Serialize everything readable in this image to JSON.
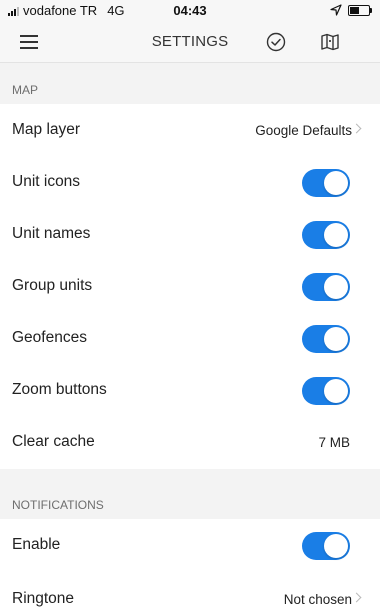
{
  "status_bar": {
    "carrier": "vodafone TR",
    "network": "4G",
    "time": "04:43",
    "battery_level": 0.5
  },
  "header": {
    "title": "SETTINGS",
    "menu_icon": "hamburger-menu-icon",
    "check_icon": "check-circle-icon",
    "map_icon": "map-icon"
  },
  "sections": {
    "map": {
      "title": "MAP",
      "map_layer": {
        "label": "Map layer",
        "value": "Google Defaults"
      },
      "unit_icons": {
        "label": "Unit icons",
        "on": true
      },
      "unit_names": {
        "label": "Unit names",
        "on": true
      },
      "group_units": {
        "label": "Group units",
        "on": true
      },
      "geofences": {
        "label": "Geofences",
        "on": true
      },
      "zoom_buttons": {
        "label": "Zoom buttons",
        "on": true
      },
      "clear_cache": {
        "label": "Clear cache",
        "value": "7 MB"
      }
    },
    "notifications": {
      "title": "NOTIFICATIONS",
      "enable": {
        "label": "Enable",
        "on": true
      },
      "ringtone": {
        "label": "Ringtone",
        "value": "Not chosen"
      }
    }
  },
  "colors": {
    "toggle_on": "#1a7ee6",
    "section_bg": "#f3f3f3",
    "chevron": "#b9b9b9"
  }
}
